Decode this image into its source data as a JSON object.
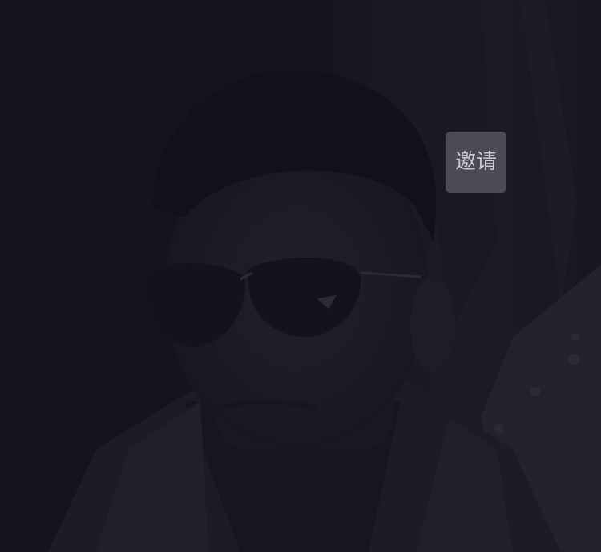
{
  "invite": {
    "label": "邀请"
  },
  "colors": {
    "background": "#15151c",
    "button_bg": "#56545e",
    "button_text": "#c9c9cf"
  }
}
